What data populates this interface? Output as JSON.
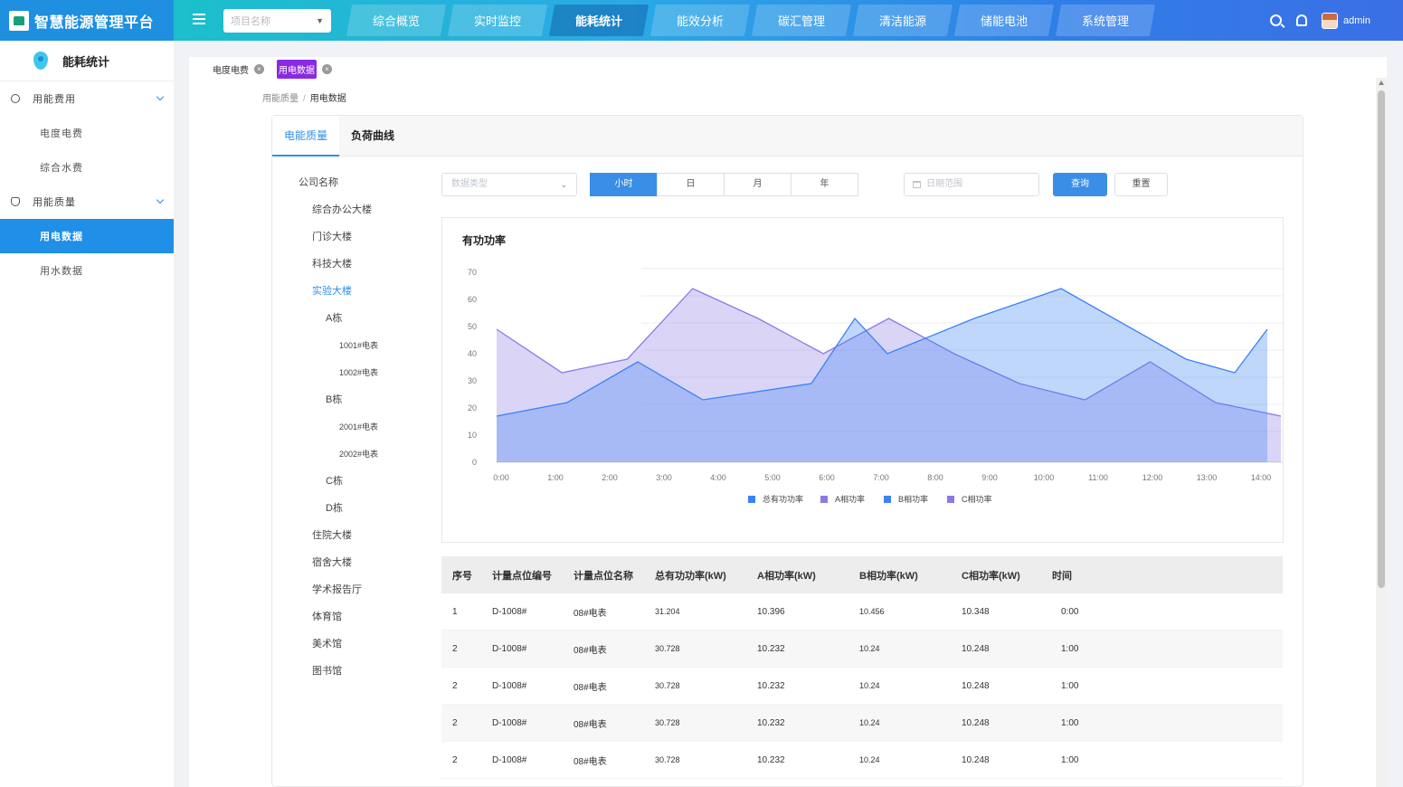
{
  "brand": {
    "title": "智慧能源管理平台"
  },
  "header": {
    "project_placeholder": "项目名称",
    "nav": [
      {
        "label": "综合概览",
        "active": false
      },
      {
        "label": "实时监控",
        "active": false
      },
      {
        "label": "能耗统计",
        "active": true
      },
      {
        "label": "能效分析",
        "active": false
      },
      {
        "label": "碳汇管理",
        "active": false
      },
      {
        "label": "清洁能源",
        "active": false
      },
      {
        "label": "储能电池",
        "active": false
      },
      {
        "label": "系统管理",
        "active": false
      }
    ],
    "username": "admin"
  },
  "sidebar": {
    "title": "能耗统计",
    "groups": [
      {
        "label": "用能费用",
        "icon": "gear-icon",
        "items": [
          {
            "label": "电度电费"
          },
          {
            "label": "综合水费"
          }
        ]
      },
      {
        "label": "用能质量",
        "icon": "shield-icon",
        "items": [
          {
            "label": "用电数据",
            "active": true
          },
          {
            "label": "用水数据"
          }
        ]
      }
    ]
  },
  "page_tabs": [
    {
      "label": "电度电费"
    },
    {
      "label": "用电数据",
      "active": true
    }
  ],
  "breadcrumb": {
    "parent": "用能质量",
    "current": "用电数据"
  },
  "panel_tabs": [
    {
      "label": "电能质量",
      "active": true
    },
    {
      "label": "负荷曲线"
    }
  ],
  "tree": {
    "root": "公司名称",
    "nodes": [
      "综合办公大楼",
      "门诊大楼",
      "科技大楼",
      "实验大楼",
      "A栋",
      "1001#电表",
      "1002#电表",
      "B栋",
      "2001#电表",
      "2002#电表",
      "C栋",
      "D栋",
      "住院大楼",
      "宿舍大楼",
      "学术报告厅",
      "体育馆",
      "美术馆",
      "图书馆"
    ],
    "selected": "实验大楼"
  },
  "filters": {
    "data_type_placeholder": "数据类型",
    "periods": [
      {
        "label": "小时",
        "active": true
      },
      {
        "label": "日"
      },
      {
        "label": "月"
      },
      {
        "label": "年"
      }
    ],
    "date_placeholder": "日期范围",
    "query_label": "查询",
    "reset_label": "重置"
  },
  "chart_title": "有功功率",
  "chart_data": {
    "type": "area",
    "title": "有功功率",
    "x": [
      "0:00",
      "1:00",
      "2:00",
      "3:00",
      "4:00",
      "5:00",
      "6:00",
      "7:00",
      "8:00",
      "9:00",
      "10:00",
      "11:00",
      "12:00",
      "13:00",
      "14:00"
    ],
    "ylim": [
      0,
      70
    ],
    "yticks": [
      0,
      10,
      20,
      30,
      40,
      50,
      60,
      70
    ],
    "grid": true,
    "legend": "bottom-center",
    "series": [
      {
        "name": "总有功功率",
        "color": "#3b82f6",
        "values": [
          17,
          22,
          37,
          23,
          29,
          53,
          40,
          53,
          64,
          38,
          33,
          49
        ]
      },
      {
        "name": "A相功率",
        "color": "#8b7ae6",
        "values": [
          49,
          33,
          38,
          64,
          53,
          40,
          53,
          40,
          29,
          23,
          37,
          22,
          17
        ]
      },
      {
        "name": "B相功率",
        "color": "#3b82f6",
        "values": []
      },
      {
        "name": "C相功率",
        "color": "#8b7ae6",
        "values": []
      }
    ]
  },
  "table": {
    "columns": [
      "序号",
      "计量点位编号",
      "计量点位名称",
      "总有功功率(kW)",
      "A相功率(kW)",
      "B相功率(kW)",
      "C相功率(kW)",
      "时间"
    ],
    "rows": [
      [
        "1",
        "D-1008#",
        "08#电表",
        "31.204",
        "10.396",
        "10.456",
        "10.348",
        "0:00"
      ],
      [
        "2",
        "D-1008#",
        "08#电表",
        "30.728",
        "10.232",
        "10.24",
        "10.248",
        "1:00"
      ],
      [
        "2",
        "D-1008#",
        "08#电表",
        "30.728",
        "10.232",
        "10.24",
        "10.248",
        "1:00"
      ],
      [
        "2",
        "D-1008#",
        "08#电表",
        "30.728",
        "10.232",
        "10.24",
        "10.248",
        "1:00"
      ],
      [
        "2",
        "D-1008#",
        "08#电表",
        "30.728",
        "10.232",
        "10.24",
        "10.248",
        "1:00"
      ]
    ]
  }
}
